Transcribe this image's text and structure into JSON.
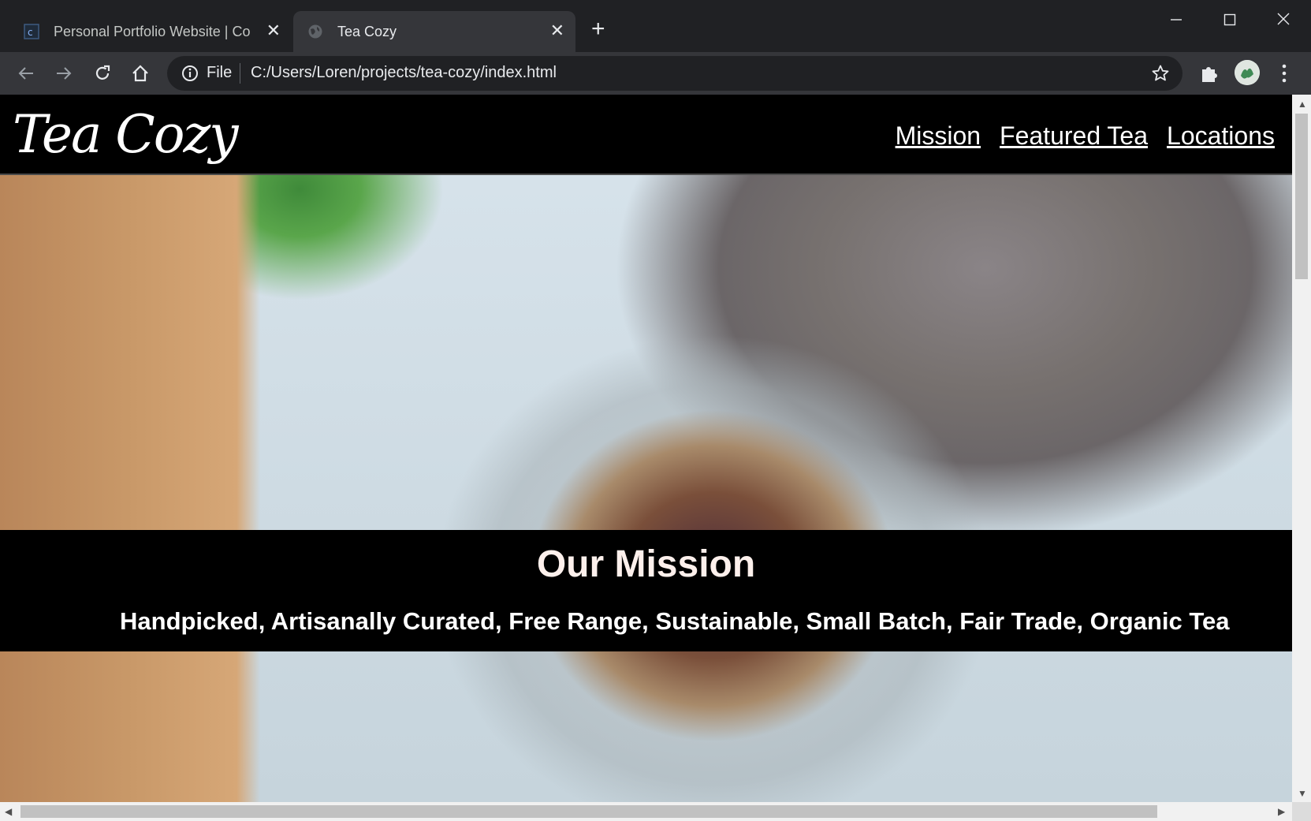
{
  "browser": {
    "tabs": [
      {
        "title": "Personal Portfolio Website | Code",
        "active": false,
        "icon": "codecademy-favicon"
      },
      {
        "title": "Tea Cozy",
        "active": true,
        "icon": "globe-favicon"
      }
    ],
    "address": {
      "scheme_label": "File",
      "url": "C:/Users/Loren/projects/tea-cozy/index.html"
    }
  },
  "site": {
    "logo": "Tea Cozy",
    "nav": [
      "Mission",
      "Featured Tea",
      "Locations"
    ],
    "mission": {
      "title": "Our Mission",
      "subtitle": "Handpicked, Artisanally Curated, Free Range, Sustainable, Small Batch, Fair Trade, Organic Tea"
    }
  },
  "colors": {
    "chrome_dark": "#202124",
    "toolbar": "#35363a",
    "header_bg": "#000000",
    "nav_text": "#ffffff",
    "mission_title": "#fdf0ec"
  }
}
